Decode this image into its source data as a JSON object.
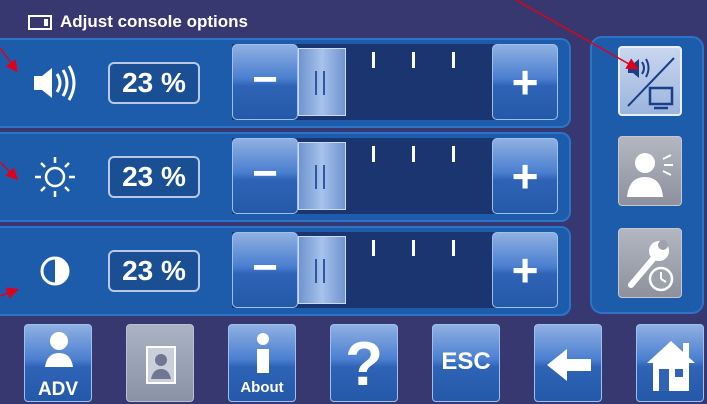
{
  "window": {
    "title": "Adjust console options"
  },
  "rows": [
    {
      "name": "volume",
      "value": "23 %",
      "level_percent": 23,
      "minus": "−",
      "plus": "+"
    },
    {
      "name": "brightness",
      "value": "23 %",
      "level_percent": 23,
      "minus": "−",
      "plus": "+"
    },
    {
      "name": "contrast",
      "value": "23 %",
      "level_percent": 23,
      "minus": "−",
      "plus": "+"
    }
  ],
  "bottom": {
    "adv_label": "ADV",
    "about_label": "About",
    "help_label": "?",
    "esc_label": "ESC"
  },
  "colors": {
    "accent": "#1d5cab",
    "panel": "#36386f",
    "annotation": "#e0001b"
  },
  "icons": [
    "volume-icon",
    "brightness-icon",
    "contrast-icon",
    "audio-display-icon",
    "user-speaker-icon",
    "wrench-clock-icon",
    "user-adv-icon",
    "user-card-icon",
    "info-icon",
    "help-icon",
    "back-arrow-icon",
    "home-icon"
  ]
}
